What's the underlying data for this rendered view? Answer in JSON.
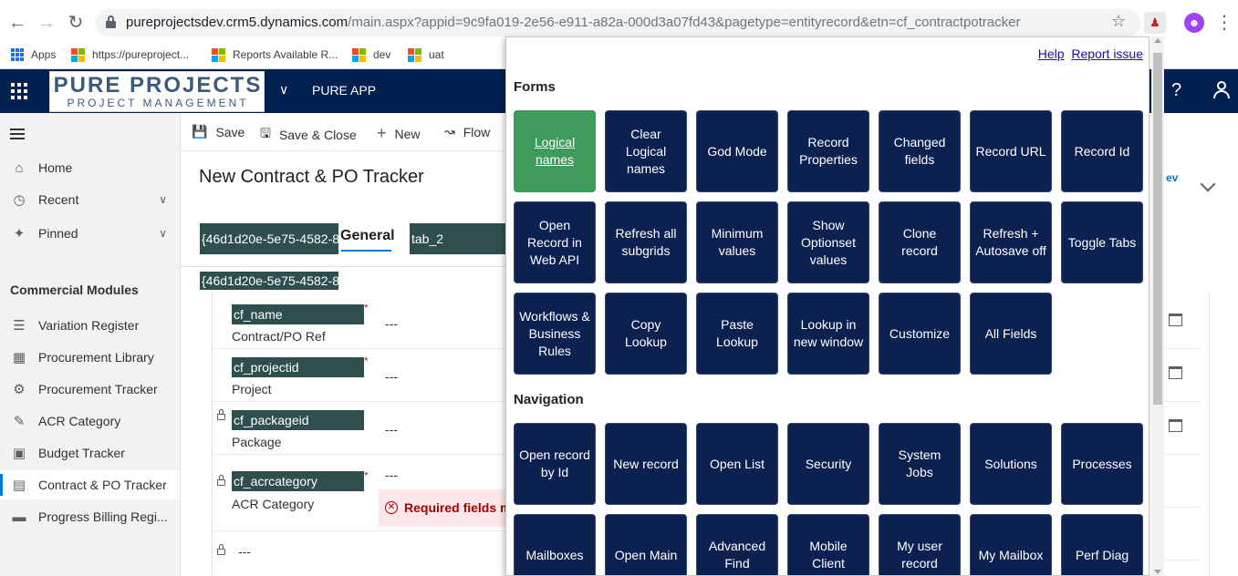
{
  "browser": {
    "url_host": "pureprojectsdev.crm5.dynamics.com",
    "url_rest": "/main.aspx?appid=9c9fa019-2e56-e911-a82a-000d3a07fd43&pagetype=entityrecord&etn=cf_contractpotracker",
    "bookmarks": [
      "Apps",
      "https://pureproject...",
      "Reports Available R...",
      "dev",
      "uat"
    ]
  },
  "header": {
    "logo_line1": "PURE PROJECTS",
    "logo_line2": "PROJECT MANAGEMENT",
    "app_name": "PURE APP",
    "help": "?"
  },
  "sidebar": {
    "top_items": [
      {
        "label": "Home",
        "icon": "home-icon"
      },
      {
        "label": "Recent",
        "icon": "clock-icon"
      },
      {
        "label": "Pinned",
        "icon": "pin-icon"
      }
    ],
    "section_title": "Commercial Modules",
    "modules": [
      {
        "label": "Variation Register",
        "icon": "list-icon"
      },
      {
        "label": "Procurement Library",
        "icon": "library-icon"
      },
      {
        "label": "Procurement Tracker",
        "icon": "tracker-icon"
      },
      {
        "label": "ACR Category",
        "icon": "category-icon"
      },
      {
        "label": "Budget Tracker",
        "icon": "budget-icon"
      },
      {
        "label": "Contract & PO Tracker",
        "icon": "contract-icon",
        "active": true
      },
      {
        "label": "Progress Billing Regi...",
        "icon": "billing-icon"
      }
    ]
  },
  "commandbar": {
    "save": "Save",
    "save_close": "Save & Close",
    "new": "New",
    "flow": "Flow"
  },
  "form": {
    "title": "New Contract & PO Tracker",
    "tab_guid": "{46d1d20e-5e75-4582-8",
    "tab_general": "General",
    "tab_2": "tab_2",
    "section_guid": "{46d1d20e-5e75-4582-8",
    "fields": [
      {
        "logical": "cf_name",
        "label": "Contract/PO Ref",
        "value": "---",
        "required": "*",
        "locked": false
      },
      {
        "logical": "cf_projectid",
        "label": "Project",
        "value": "---",
        "required": "*",
        "locked": false
      },
      {
        "logical": "cf_packageid",
        "label": "Package",
        "value": "---",
        "required": "",
        "locked": true
      },
      {
        "logical": "cf_acrcategory",
        "label": "ACR Category",
        "value": "---",
        "required": "*",
        "locked": true
      }
    ],
    "last_value": "---",
    "error_text": "Required fields m",
    "right_link": "ev"
  },
  "panel": {
    "help": "Help",
    "report_issue": "Report issue",
    "forms_title": "Forms",
    "forms": [
      "Logical names",
      "Clear Logical names",
      "God Mode",
      "Record Properties",
      "Changed fields",
      "Record URL",
      "Record Id",
      "Open Record in Web API",
      "Refresh all subgrids",
      "Minimum values",
      "Show Optionset values",
      "Clone record",
      "Refresh + Autosave off",
      "Toggle Tabs",
      "Workflows & Business Rules",
      "Copy Lookup",
      "Paste Lookup",
      "Lookup in new window",
      "Customize",
      "All Fields"
    ],
    "navigation_title": "Navigation",
    "navigation": [
      "Open record by Id",
      "New record",
      "Open List",
      "Security",
      "System Jobs",
      "Solutions",
      "Processes",
      "Mailboxes",
      "Open Main",
      "Advanced Find",
      "Mobile Client",
      "My user record",
      "My Mailbox",
      "Perf Diag"
    ],
    "active_color": "#3f9b5b",
    "tile_color": "#0c2150"
  }
}
